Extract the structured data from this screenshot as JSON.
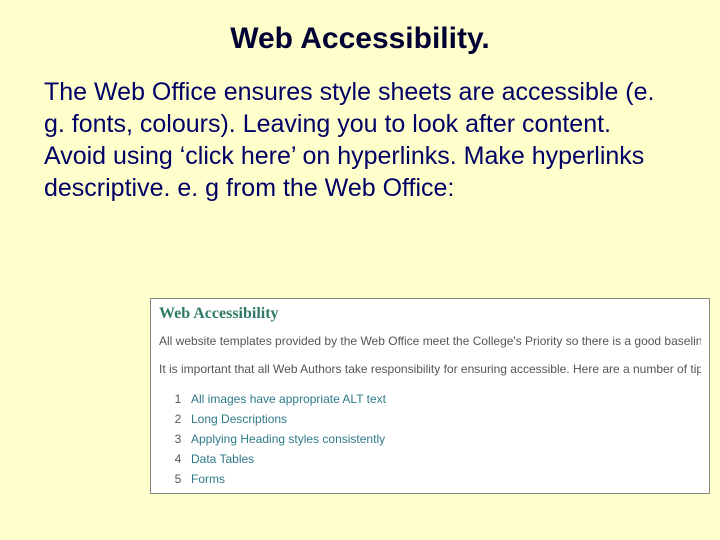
{
  "title": "Web Accessibility.",
  "body": {
    "p1": "The Web Office ensures style sheets are accessible (e. g. fonts, colours). Leaving you to look after content.",
    "p2": "Avoid using ‘click here’ on hyperlinks. Make hyperlinks descriptive. e. g from the Web Office:"
  },
  "snippet": {
    "heading": "Web Accessibility",
    "para1": "All website templates provided by the Web Office meet the College's Priority so there is a good baseline in place.",
    "para2": "It is important that all Web Authors take responsibility for ensuring accessible. Here are a number of tips to assist with this task.",
    "items": [
      {
        "n": "1",
        "label": "All images have appropriate ALT text"
      },
      {
        "n": "2",
        "label": "Long Descriptions"
      },
      {
        "n": "3",
        "label": "Applying Heading styles consistently"
      },
      {
        "n": "4",
        "label": "Data Tables"
      },
      {
        "n": "5",
        "label": "Forms"
      }
    ]
  }
}
